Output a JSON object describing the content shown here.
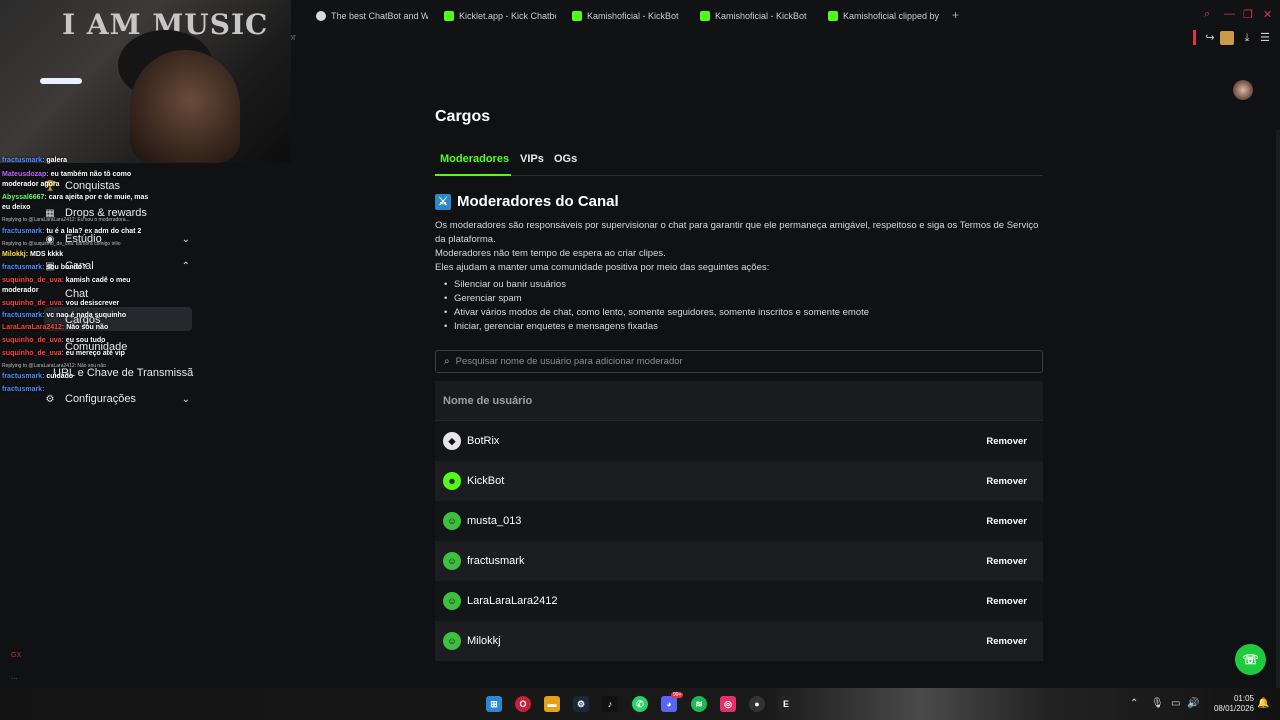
{
  "browser": {
    "tabs": [
      {
        "label": "The best ChatBot and Wid",
        "color": "#d9d9d9"
      },
      {
        "label": "Kicklet.app - Kick Chatbo",
        "color": "#53fc18"
      },
      {
        "label": "Kamishoficial - KickBot",
        "color": "#53fc18"
      },
      {
        "label": "Kamishoficial - KickBot",
        "color": "#53fc18"
      },
      {
        "label": "Kamishoficial clipped by fr",
        "color": "#53fc18"
      }
    ],
    "new_tab": "+",
    "address_fragment": "or"
  },
  "webcam": {
    "sign_text": "I AM MUSIC"
  },
  "sidebar": {
    "items": [
      {
        "label": "Conquistas",
        "icon": "trophy-icon"
      },
      {
        "label": "Drops & rewards",
        "icon": "gift-icon"
      },
      {
        "label": "Estúdio",
        "icon": "studio-icon"
      },
      {
        "label": "Canal",
        "icon": "channel-icon"
      },
      {
        "label": "Chat"
      },
      {
        "label": "Cargos"
      },
      {
        "label": "Comunidade"
      },
      {
        "label": "URL e Chave de Transmissã"
      },
      {
        "label": "Configurações",
        "icon": "gear-icon"
      }
    ]
  },
  "chat": {
    "messages": [
      {
        "user": "fractusmark:",
        "text": "galera",
        "color": "#4a8cff"
      },
      {
        "user": "Mateusdozap:",
        "text": "eu também não tô como",
        "color": "#c266ff"
      },
      {
        "user": "moderador",
        "text": "agora",
        "color": "#ffffff"
      },
      {
        "user": "Abyssal6667:",
        "text": "cara ajeita por e de muie, mas",
        "color": "#66ff66"
      },
      {
        "user": "eu deixo",
        "text": "",
        "color": "#ffffff"
      },
      {
        "reply": "Replying to @LaraLaraLara2412: Eu sou o moderadora..."
      },
      {
        "user": "fractusmark:",
        "text": "tu é a lala? ex adm do chat 2",
        "color": "#4a8cff"
      },
      {
        "reply": "Replying to @suquinho_de_uva: bamora comigo irilio"
      },
      {
        "user": "Milokkj:",
        "text": "MDS kkkk",
        "color": "#ffe14d"
      },
      {
        "user": "fractusmark:",
        "text": "sou bonito?",
        "color": "#4a8cff"
      },
      {
        "user": "suquinho_de_uva:",
        "text": "kamish cadê o meu",
        "color": "#ff4040"
      },
      {
        "user": "moderador",
        "text": "",
        "color": "#ffffff"
      },
      {
        "user": "suquinho_de_uva:",
        "text": "vou desiscrever",
        "color": "#ff4040"
      },
      {
        "user": "fractusmark:",
        "text": "vc nao é nada suquinho",
        "color": "#4a8cff"
      },
      {
        "user": "LaraLaraLara2412:",
        "text": "Não sou não",
        "color": "#ff4040"
      },
      {
        "user": "suquinho_de_uva:",
        "text": "eu sou tudo",
        "color": "#ff4040"
      },
      {
        "user": "suquinho_de_uva:",
        "text": "eu mereço até vip",
        "color": "#ff4040"
      },
      {
        "reply": "Replying to @LaraLaraLara2412: Não sou não"
      },
      {
        "user": "fractusmark:",
        "text": "cuidado",
        "color": "#4a8cff"
      },
      {
        "user": "fractusmark:",
        "text": "",
        "color": "#4a8cff"
      }
    ],
    "footer_gx": "GX",
    "footer_dots": "..."
  },
  "page": {
    "title": "Cargos",
    "tabs": [
      "Moderadores",
      "VIPs",
      "OGs"
    ],
    "section_title": "Moderadores do Canal",
    "description": [
      "Os moderadores são responsáveis por supervisionar o chat para garantir que ele permaneça amigável, respeitoso e siga os Termos de Serviço da plataforma.",
      "Moderadores não tem tempo de espera ao criar clipes.",
      "Eles ajudam a manter uma comunidade positiva por meio das seguintes ações:"
    ],
    "bullets": [
      "Silenciar ou banir usuários",
      "Gerenciar spam",
      "Ativar vários modos de chat, como lento, somente seguidores, somente inscritos e somente emote",
      "Iniciar, gerenciar enquetes e mensagens fixadas"
    ],
    "search_placeholder": "Pesquisar nome de usuário para adicionar moderador",
    "table_header": "Nome de usuário",
    "remove_label": "Remover",
    "moderators": [
      {
        "name": "BotRix",
        "avatar_color": "#e6e6e6"
      },
      {
        "name": "KickBot",
        "avatar_color": "#53fc18"
      },
      {
        "name": "musta_013",
        "avatar_color": "#3fbf3f"
      },
      {
        "name": "fractusmark",
        "avatar_color": "#3fbf3f"
      },
      {
        "name": "LaraLaraLara2412",
        "avatar_color": "#3fbf3f"
      },
      {
        "name": "Milokkj",
        "avatar_color": "#3fbf3f"
      }
    ]
  },
  "taskbar": {
    "time": "01:05",
    "date": "08/01/2026",
    "discord_badge": "99+"
  },
  "accent_color": "#53fc18"
}
